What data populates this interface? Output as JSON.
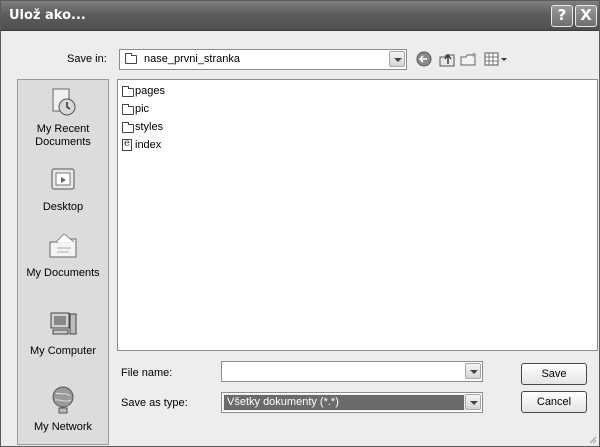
{
  "window": {
    "title": "Ulož ako...",
    "help_label": "?",
    "close_label": "X"
  },
  "save_in": {
    "label": "Save in:",
    "value": "nase_prvni_stranka"
  },
  "places": [
    {
      "label": "My Recent Documents",
      "icon": "recent-documents-icon"
    },
    {
      "label": "Desktop",
      "icon": "desktop-icon"
    },
    {
      "label": "My Documents",
      "icon": "my-documents-icon"
    },
    {
      "label": "My Computer",
      "icon": "my-computer-icon"
    },
    {
      "label": "My Network",
      "icon": "my-network-icon"
    }
  ],
  "files": [
    {
      "name": "pages",
      "type": "folder"
    },
    {
      "name": "pic",
      "type": "folder"
    },
    {
      "name": "styles",
      "type": "folder"
    },
    {
      "name": "index",
      "type": "document"
    }
  ],
  "file_name": {
    "label": "File name:",
    "value": ""
  },
  "save_as_type": {
    "label": "Save as type:",
    "value": "Všetky dokumenty (*.*)"
  },
  "buttons": {
    "save": "Save",
    "cancel": "Cancel"
  }
}
